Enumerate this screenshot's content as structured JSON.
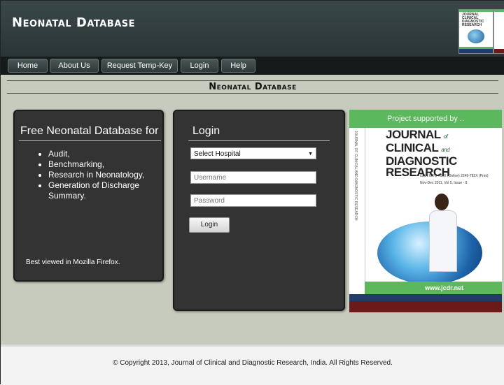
{
  "header": {
    "site_title": "Neonatal Database",
    "thumb_title": "JOURNAL of CLINICAL and DIAGNOSTIC RESEARCH"
  },
  "nav": {
    "items": [
      {
        "label": "Home"
      },
      {
        "label": "About Us"
      },
      {
        "label": "Request Temp-Key"
      },
      {
        "label": "Login"
      },
      {
        "label": "Help"
      }
    ]
  },
  "main": {
    "heading": "Neonatal Database"
  },
  "info_panel": {
    "title": "Free Neonatal Database for",
    "features": [
      "Audit,",
      "Benchmarking,",
      "Research in Neonatology,",
      "Generation of Discharge Summary."
    ],
    "browser_note": "Best viewed in Mozilla Firefox."
  },
  "login_panel": {
    "title": "Login",
    "hospital_select": "Select Hospital",
    "username_placeholder": "Username",
    "password_placeholder": "Password",
    "button_label": "Login"
  },
  "ad": {
    "supported_by": "Project supported by ..",
    "journal_title_1": "JOURNAL",
    "journal_of": "of",
    "journal_title_2": "CLINICAL",
    "journal_and": "and",
    "journal_title_3": "DIAGNOSTIC",
    "journal_title_4": "RESEARCH",
    "issn": "ISSN 0973-709X (Online)   2249-782X (Print)",
    "issue": "Nov-Dec 2011, Vol 5, Issue - 8",
    "spine_text": "JOURNAL OF CLINICAL AND DIAGNOSTIC RESEARCH",
    "url": "www.jcdr.net",
    "colors": {
      "green": "#5cb85c",
      "navy": "#1f3d6b",
      "maroon": "#6b1a1a"
    }
  },
  "footer": {
    "copyright": "© Copyright 2013, Journal of Clinical and Diagnostic Research, India. All Rights Reserved."
  }
}
